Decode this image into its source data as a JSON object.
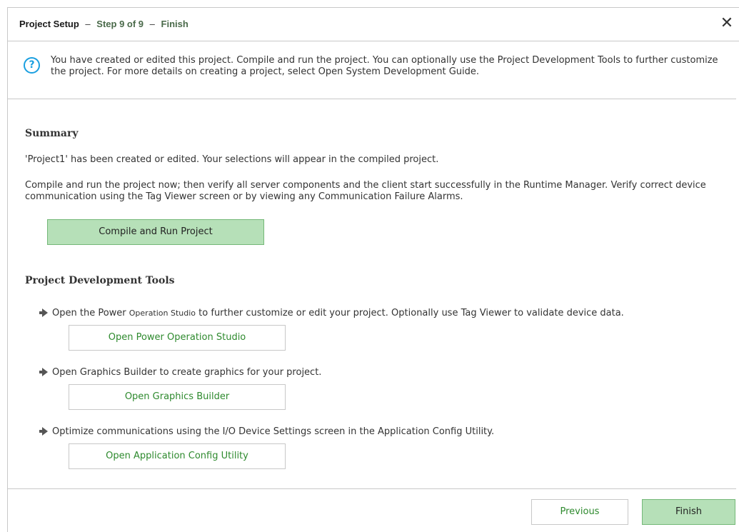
{
  "header": {
    "title_bold": "Project Setup",
    "sep1": "–",
    "step": "Step 9 of 9",
    "sep2": "–",
    "page": "Finish",
    "close_glyph": "✕"
  },
  "info": {
    "icon": "?",
    "text": "You have created or edited this project.  Compile and run the project.  You can optionally use the Project Development Tools to further customize the project.  For more details on creating a project, select Open System Development Guide."
  },
  "summary": {
    "heading": "Summary",
    "line1": "'Project1' has been created or edited. Your selections will appear in the compiled project.",
    "line2": "Compile and run the project now; then verify all server components and the client start successfully in the Runtime Manager.  Verify correct device communication using the Tag Viewer screen or by viewing any Communication Failure Alarms.",
    "compile_button": "Compile and Run Project"
  },
  "tools": {
    "heading": "Project Development Tools",
    "items": [
      {
        "text_before": "Open the Power ",
        "text_small": "Operation Studio",
        "text_after": " to further customize or edit your project. Optionally use Tag Viewer to validate device data.",
        "button": "Open Power Operation Studio"
      },
      {
        "text": "Open Graphics Builder to create graphics for your project.",
        "button": "Open Graphics Builder"
      },
      {
        "text": "Optimize communications using the I/O Device Settings screen in the Application Config Utility.",
        "button": "Open Application Config Utility"
      }
    ]
  },
  "footer": {
    "previous": "Previous",
    "finish": "Finish"
  },
  "colors": {
    "accent_green": "#b6e0b8",
    "link_green": "#2e8a2e",
    "info_blue": "#1a9fe0"
  },
  "icons": [
    "help-icon",
    "close-icon",
    "arrow-right-icon"
  ]
}
